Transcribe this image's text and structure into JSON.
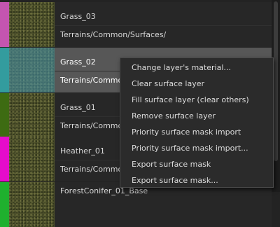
{
  "layers": [
    {
      "name": "Grass_03",
      "path": "Terrains/Common/Surfaces/",
      "color": "#c455b0",
      "selected": false
    },
    {
      "name": "Grass_02",
      "path": "Terrains/Common/Surfaces/",
      "color": "#1ea58a",
      "selected": true
    },
    {
      "name": "Grass_01",
      "path": "Terrains/Common/Surfaces/",
      "color": "#3d6b12",
      "selected": false
    },
    {
      "name": "Heather_01",
      "path": "Terrains/Common/Surfaces/",
      "color": "#e50ccb",
      "selected": false
    },
    {
      "name": "ForestConifer_01_Base",
      "path": "",
      "color": "#1fb02e",
      "selected": false
    }
  ],
  "context_menu": {
    "items": [
      "Change layer's material...",
      "Clear surface layer",
      "Fill surface layer (clear others)",
      "Remove surface layer",
      "Priority surface mask import",
      "Priority surface mask import...",
      "Export surface mask",
      "Export surface mask..."
    ]
  }
}
